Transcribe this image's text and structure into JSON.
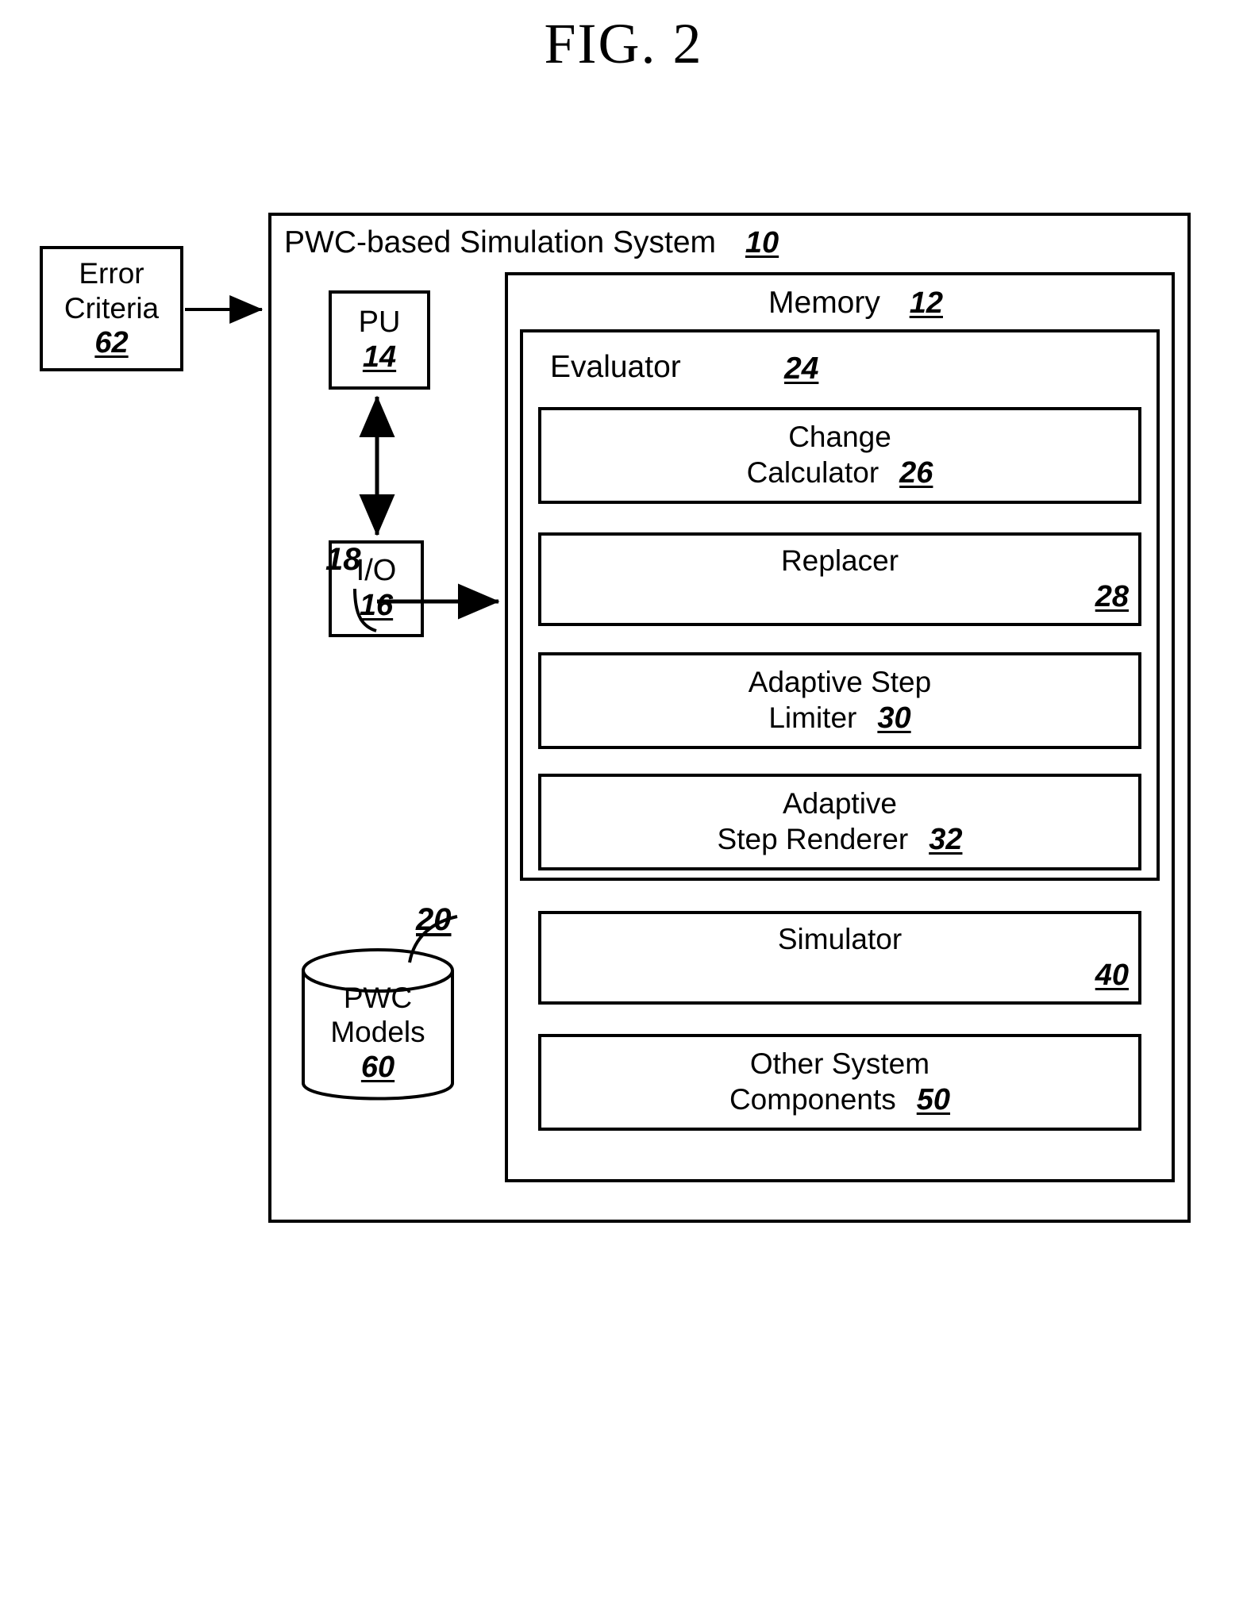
{
  "figure": {
    "title": "FIG. 2"
  },
  "external": {
    "error_criteria": {
      "line1": "Error",
      "line2": "Criteria",
      "ref": "62"
    }
  },
  "system": {
    "title": "PWC-based Simulation System",
    "ref": "10",
    "pu": {
      "label": "PU",
      "ref": "14"
    },
    "io": {
      "label": "I/O",
      "ref": "16"
    },
    "bus": {
      "ref": "18"
    },
    "database": {
      "line1": "PWC",
      "line2": "Models",
      "ref": "60",
      "connector_ref": "20"
    },
    "memory": {
      "title": "Memory",
      "ref": "12",
      "evaluator": {
        "title": "Evaluator",
        "ref": "24",
        "components": [
          {
            "line1": "Change",
            "line2": "Calculator",
            "ref": "26"
          },
          {
            "line1": "",
            "line2": "Replacer",
            "ref": "28"
          },
          {
            "line1": "Adaptive Step",
            "line2": "Limiter",
            "ref": "30"
          },
          {
            "line1": "Adaptive",
            "line2": "Step Renderer",
            "ref": "32"
          }
        ]
      },
      "components": [
        {
          "line1": "",
          "line2": "Simulator",
          "ref": "40"
        },
        {
          "line1": "Other System",
          "line2": "Components",
          "ref": "50"
        }
      ]
    }
  },
  "colors": {
    "stroke": "#000000",
    "background": "#ffffff"
  }
}
